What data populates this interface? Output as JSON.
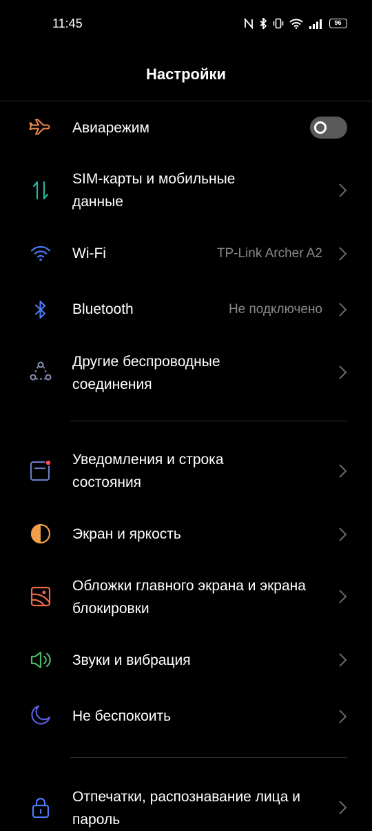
{
  "status_bar": {
    "time": "11:45",
    "battery": "96",
    "icons": [
      "nfc-icon",
      "bluetooth-icon",
      "vibrate-icon",
      "wifi-icon",
      "signal-icon",
      "battery-icon"
    ]
  },
  "header": {
    "title": "Настройки"
  },
  "groups": [
    {
      "items": [
        {
          "label": "Авиарежим",
          "icon": "airplane-icon",
          "icon_color": "#f08a4b",
          "control": "toggle",
          "toggle_state": "off"
        },
        {
          "label": "SIM-карты и мобильные данные",
          "icon": "mobile-data-icon",
          "icon_color": "#27b5a0",
          "control": "chevron"
        },
        {
          "label": "Wi-Fi",
          "value": "TP-Link Archer A2",
          "icon": "wifi-icon",
          "icon_color": "#4e7cf6",
          "control": "chevron"
        },
        {
          "label": "Bluetooth",
          "value": "Не подключено",
          "icon": "bluetooth-icon",
          "icon_color": "#4e7cf6",
          "control": "chevron"
        },
        {
          "label": "Другие беспроводные соединения",
          "icon": "connections-icon",
          "icon_color": "#8a93b5",
          "control": "chevron"
        }
      ]
    },
    {
      "items": [
        {
          "label": "Уведомления и строка состояния",
          "icon": "notification-icon",
          "icon_color": "#6e7ac0",
          "badge_color": "#ff4b4b",
          "control": "chevron"
        },
        {
          "label": "Экран и яркость",
          "icon": "brightness-icon",
          "icon_color": "#f0a04b",
          "control": "chevron"
        },
        {
          "label": "Обложки главного экрана и экрана блокировки",
          "icon": "wallpaper-icon",
          "icon_color": "#f06a4b",
          "control": "chevron"
        },
        {
          "label": "Звуки и вибрация",
          "icon": "sound-icon",
          "icon_color": "#4bb86a",
          "control": "chevron"
        },
        {
          "label": "Не беспокоить",
          "icon": "moon-icon",
          "icon_color": "#5a5ee0",
          "control": "chevron"
        }
      ]
    },
    {
      "items": [
        {
          "label": "Отпечатки, распознавание лица и пароль",
          "icon": "lock-icon",
          "icon_color": "#4e7cf6",
          "control": "chevron"
        }
      ]
    }
  ]
}
